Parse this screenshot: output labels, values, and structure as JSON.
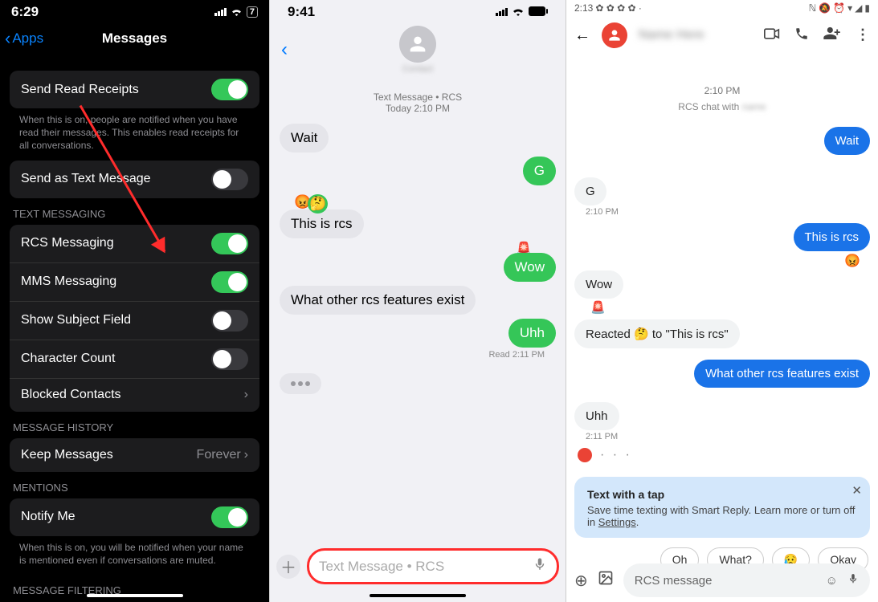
{
  "panel1": {
    "status": {
      "time": "6:29",
      "battery": "7"
    },
    "nav": {
      "back": "Apps",
      "title": "Messages"
    },
    "rows": {
      "readReceipts": {
        "label": "Send Read Receipts",
        "footer": "When this is on, people are notified when you have read their messages. This enables read receipts for all conversations."
      },
      "sendAsText": "Send as Text Message"
    },
    "textMessagingHeader": "TEXT MESSAGING",
    "tm": {
      "rcs": "RCS Messaging",
      "mms": "MMS Messaging",
      "subject": "Show Subject Field",
      "charCount": "Character Count",
      "blocked": "Blocked Contacts"
    },
    "historyHeader": "MESSAGE HISTORY",
    "keep": {
      "label": "Keep Messages",
      "value": "Forever"
    },
    "mentionsHeader": "MENTIONS",
    "notify": {
      "label": "Notify Me",
      "footer": "When this is on, you will be notified when your name is mentioned even if conversations are muted."
    },
    "filterHeader": "MESSAGE FILTERING"
  },
  "panel2": {
    "status": {
      "time": "9:41"
    },
    "meta": {
      "line1": "Text Message • RCS",
      "line2": "Today 2:10 PM"
    },
    "msgs": {
      "wait": "Wait",
      "g": "G",
      "thisIsRcs": "This is rcs",
      "wow": "Wow",
      "otherFeatures": "What other rcs features exist",
      "uhh": "Uhh",
      "read": "Read 2:11 PM"
    },
    "reactions": {
      "r1": "😡",
      "r2": "🤔",
      "r3": "🚨"
    },
    "input": {
      "placeholder": "Text Message • RCS"
    }
  },
  "panel3": {
    "status": {
      "time": "2:13"
    },
    "timestamp": "2:10 PM",
    "rcsLabel": "RCS chat with",
    "msgs": {
      "wait": "Wait",
      "g": "G",
      "gTime": "2:10 PM",
      "thisIsRcs": "This is rcs",
      "reactAngry": "😡",
      "wow": "Wow",
      "siren": "🚨",
      "reacted": "Reacted 🤔 to \"This is rcs\"",
      "otherFeatures": "What other rcs features exist",
      "uhh": "Uhh",
      "uhhTime": "2:11 PM"
    },
    "tip": {
      "title": "Text with a tap",
      "body1": "Save time texting with Smart Reply. Learn more or turn off in ",
      "link": "Settings",
      "body2": "."
    },
    "smartReplies": {
      "r1": "Oh",
      "r2": "What?",
      "r3": "😥",
      "r4": "Okay"
    },
    "input": {
      "placeholder": "RCS message"
    }
  }
}
